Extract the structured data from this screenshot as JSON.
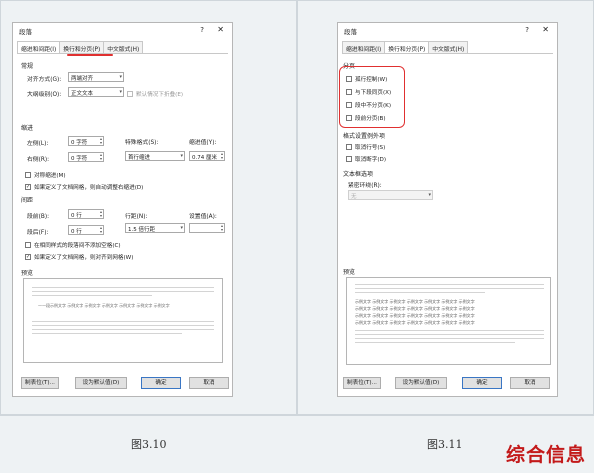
{
  "figure_left": {
    "caption": "图3.10",
    "dialog": {
      "title": "段落",
      "help": "?",
      "close": "✕",
      "tabs": [
        "缩进和间距(I)",
        "换行和分页(P)",
        "中文版式(H)"
      ],
      "general": {
        "heading": "常规",
        "align_label": "对齐方式(G):",
        "align_value": "两端对齐",
        "outline_label": "大纲级别(O):",
        "outline_value": "正文文本",
        "collapsed": "默认情况下折叠(E)"
      },
      "indent": {
        "heading": "缩进",
        "left_label": "左侧(L):",
        "left_value": "0 字符",
        "right_label": "右侧(R):",
        "right_value": "0 字符",
        "special_label": "特殊格式(S):",
        "special_value": "首行缩进",
        "by_label": "缩进值(Y):",
        "by_value": "0.74 厘米",
        "mirror": "对称缩进(M)",
        "auto_adjust": "如果定义了文档网格，则自动调整右缩进(D)"
      },
      "spacing": {
        "heading": "间距",
        "before_label": "段前(B):",
        "before_value": "0 行",
        "after_label": "段后(F):",
        "after_value": "0 行",
        "line_label": "行距(N):",
        "line_value": "1.5 倍行距",
        "at_label": "设置值(A):",
        "at_value": "",
        "no_space": "在相同样式的段落间不添加空格(C)",
        "snap_grid": "如果定义了文档网格，则对齐到网格(W)"
      },
      "preview_label": "预览",
      "preview_text": "一一段示例文字 示例文字 示例文字 示例文字 示例文字 示例文字 示例文字",
      "buttons": {
        "tabs": "制表位(T)...",
        "default": "设为默认值(D)",
        "ok": "确定",
        "cancel": "取消"
      }
    }
  },
  "figure_right": {
    "caption": "图3.11",
    "dialog": {
      "title": "段落",
      "help": "?",
      "close": "✕",
      "tabs": [
        "缩进和间距(I)",
        "换行和分页(P)",
        "中文版式(H)"
      ],
      "pagination": {
        "heading": "分页",
        "widow": "孤行控制(W)",
        "keep_next": "与下段同页(X)",
        "keep_lines": "段中不分页(K)",
        "page_break": "段前分页(B)"
      },
      "exceptions": {
        "heading": "格式设置例外项",
        "suppress_numbers": "取消行号(S)",
        "no_hyphen": "取消断字(D)"
      },
      "textbox": {
        "heading": "文本框选项",
        "wrap_label": "紧密环绕(R):",
        "wrap_value": "无"
      },
      "preview_label": "预览",
      "preview_text": "示例文字 示例文字 示例文字 示例文字 示例文字 示例文字 示例文字",
      "buttons": {
        "tabs": "制表位(T)...",
        "default": "设为默认值(D)",
        "ok": "确定",
        "cancel": "取消"
      }
    }
  },
  "watermark": "综合信息",
  "colors": {
    "annotation_red": "#e03030",
    "watermark_red": "#c31a1a"
  }
}
